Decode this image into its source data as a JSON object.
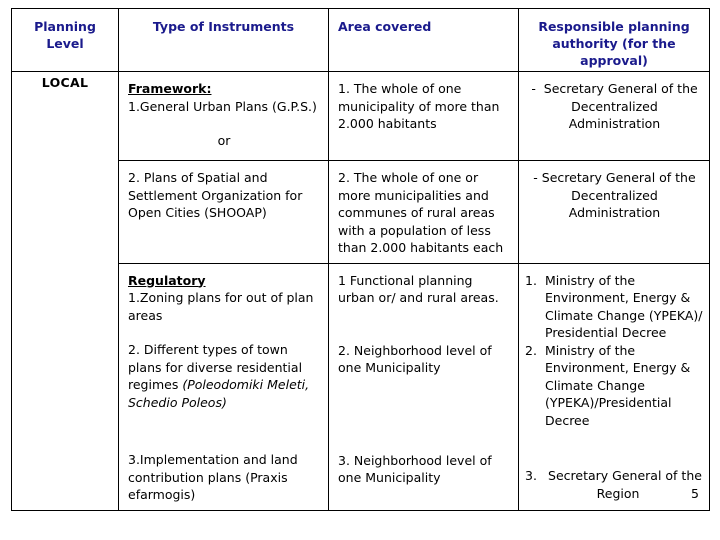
{
  "table": {
    "headers": [
      "Planning Level",
      "Type of Instruments",
      "Area covered",
      "Responsible planning authority (for the approval)"
    ],
    "header_bg": "#fbc69a",
    "header_text_color": "#1a1a8c",
    "planning_level": "LOCAL",
    "framework": {
      "heading": "Framework:",
      "item1": "1.General Urban Plans (G.P.S.)",
      "or": "or",
      "item2": "2. Plans of Spatial and Settlement Organization for Open Cities (SHOOAP)",
      "area1": "1. The whole of one municipality of more than 2.000 habitants",
      "area2": "2. The whole of one or more municipalities and communes of rural areas with a population of less than 2.000 habitants each",
      "authority1_bullet": "-",
      "authority1": "Secretary General of the Decentralized Administration",
      "authority2": "- Secretary General of the Decentralized Administration"
    },
    "regulatory": {
      "heading": "Regulatory",
      "item1": "1.Zoning plans for out of plan areas",
      "item2_plain": "2. Different types of town plans for diverse residential regimes ",
      "item2_italic": "(Poleodomiki Meleti, Schedio Poleos)",
      "item3": "3.Implementation and land contribution plans (Praxis efarmogis)",
      "area1": "1 Functional planning urban or/ and rural areas.",
      "area2": "2. Neighborhood level of one Municipality",
      "area3": "3. Neighborhood level of one Municipality",
      "auth1_num": "1.",
      "auth1_text": "Ministry of the Environment, Energy & Climate Change (YPEKA)/ Presidential Decree",
      "auth2_num": "2.",
      "auth2_text": " Ministry of the Environment, Energy & Climate Change (YPEKA)/Presidential Decree",
      "auth3_num": "3.",
      "auth3_text": "Secretary General of the Region"
    },
    "page_number": "5"
  }
}
